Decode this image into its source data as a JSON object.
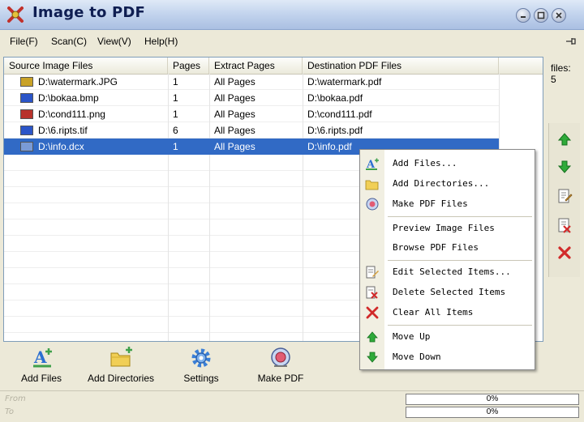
{
  "window": {
    "title": "Image to PDF"
  },
  "menu": [
    {
      "label": "File(F)"
    },
    {
      "label": "Scan(C)"
    },
    {
      "label": "View(V)"
    },
    {
      "label": "Help(H)"
    }
  ],
  "table": {
    "columns": [
      "Source Image Files",
      "Pages",
      "Extract Pages",
      "Destination PDF Files"
    ],
    "rows": [
      {
        "icon": "jpg-file-icon",
        "icon_color": "#c9a227",
        "source": "D:\\watermark.JPG",
        "pages": "1",
        "extract": "All Pages",
        "dest": "D:\\watermark.pdf",
        "selected": false
      },
      {
        "icon": "bmp-file-icon",
        "icon_color": "#2b55c8",
        "source": "D:\\bokaa.bmp",
        "pages": "1",
        "extract": "All Pages",
        "dest": "D:\\bokaa.pdf",
        "selected": false
      },
      {
        "icon": "png-file-icon",
        "icon_color": "#b8322b",
        "source": "D:\\cond111.png",
        "pages": "1",
        "extract": "All Pages",
        "dest": "D:\\cond111.pdf",
        "selected": false
      },
      {
        "icon": "tif-file-icon",
        "icon_color": "#2b55c8",
        "source": "D:\\6.ripts.tif",
        "pages": "6",
        "extract": "All Pages",
        "dest": "D:\\6.ripts.pdf",
        "selected": false
      },
      {
        "icon": "dcx-file-icon",
        "icon_color": "#7a9bd6",
        "source": "D:\\info.dcx",
        "pages": "1",
        "extract": "All Pages",
        "dest": "D:\\info.pdf",
        "selected": true
      }
    ]
  },
  "files_info": {
    "label": "files:",
    "count": "5"
  },
  "toolbar": {
    "add_files": "Add Files",
    "add_directories": "Add Directories",
    "settings": "Settings",
    "make_pdf": "Make PDF"
  },
  "status": {
    "from_label": "From",
    "to_label": "To",
    "progress1_text": "0%",
    "progress1_value": 0,
    "progress2_text": "0%",
    "progress2_value": 0
  },
  "context_menu": [
    {
      "label": "Add Files...",
      "icon": "add-files-icon"
    },
    {
      "label": "Add Directories...",
      "icon": "folder-icon"
    },
    {
      "label": "Make PDF Files",
      "icon": "make-pdf-icon"
    },
    {
      "label": "Preview Image Files",
      "icon": ""
    },
    {
      "label": "Browse PDF Files",
      "icon": ""
    },
    {
      "label": "Edit Selected Items...",
      "icon": "edit-icon"
    },
    {
      "label": "Delete Selected Items",
      "icon": "delete-icon"
    },
    {
      "label": "Clear All Items",
      "icon": "clear-icon"
    },
    {
      "label": "Move Up",
      "icon": "arrow-up-icon"
    },
    {
      "label": "Move Down",
      "icon": "arrow-down-icon"
    }
  ],
  "colors": {
    "selection": "#316ac5",
    "title_bar": "#c4d5ee",
    "window_bg": "#ece9d8"
  }
}
